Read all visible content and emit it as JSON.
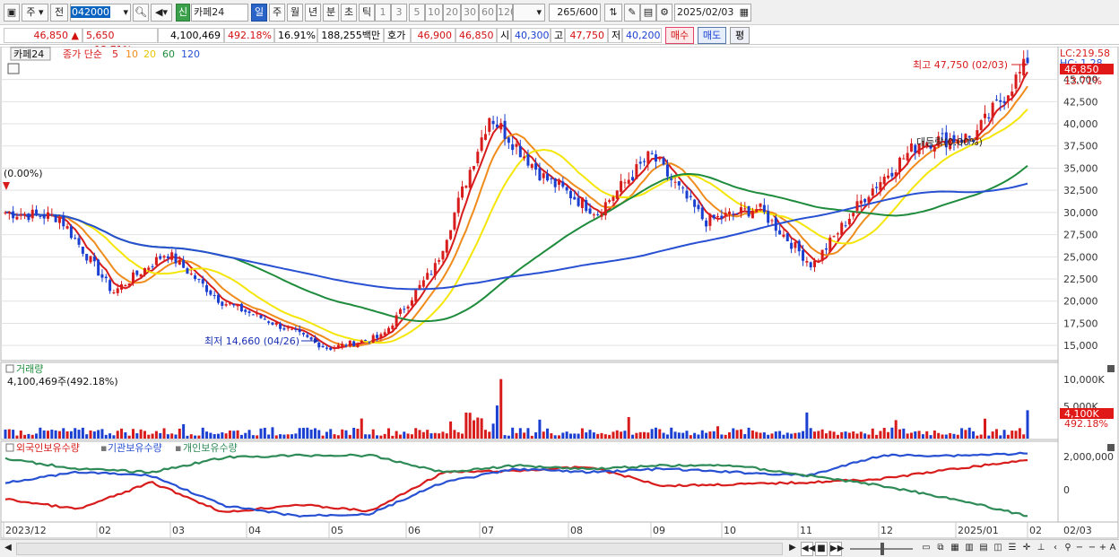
{
  "toolbar": {
    "period_label": "주",
    "prev_label": "전",
    "code_value": "042000",
    "credit_badge": "신",
    "stock_name": "카페24",
    "timeframes": [
      "일",
      "주",
      "월",
      "년",
      "분",
      "초",
      "틱"
    ],
    "active_timeframe": "일",
    "intervals": [
      "1",
      "3",
      "5",
      "10",
      "20",
      "30",
      "60",
      "120"
    ],
    "count_value": "265",
    "count_total": "/600",
    "date_value": "2025/02/03"
  },
  "quote": {
    "price": "46,850",
    "change_arrow": "▲",
    "change": "5,650",
    "change_pct": "+13.71%",
    "volume": "4,100,469",
    "volume_ratio": "492.18%",
    "turnover": "16.91%",
    "amount": "188,255백만",
    "ask_label": "호가",
    "ask_price": "46,900",
    "bid_price": "46,850",
    "open_label": "시",
    "open": "40,300",
    "high_label": "고",
    "high": "47,750",
    "low_label": "저",
    "low": "40,200",
    "buy_label": "매수",
    "sell_label": "매도",
    "eval_label": "평"
  },
  "price_panel": {
    "legend_name": "카페24",
    "legend_ma": "종가 단순",
    "ma_periods": [
      "5",
      "10",
      "20",
      "60",
      "120"
    ],
    "ma_colors": [
      "#d81c1c",
      "#f08c1c",
      "#f5e60a",
      "#1e8c3c",
      "#2850d2"
    ],
    "left_pct": "(0.00%)",
    "high_annot": "최고 47,750 (02/03)",
    "low_annot": "최저 14,660 (04/26)",
    "mid_annot": "대등락(0.00%)",
    "lc_label": "LC:219.58",
    "hc_label": "HC: 1.28",
    "current_price_tag": "46,850",
    "current_pct_tag": "13.71%",
    "y_ticks": [
      "45,000",
      "42,500",
      "40,000",
      "37,500",
      "35,000",
      "32,500",
      "30,000",
      "27,500",
      "25,000",
      "22,500",
      "20,000",
      "17,500",
      "15,000"
    ]
  },
  "volume_panel": {
    "title": "거래량",
    "value_text": "4,100,469주(492.18%)",
    "y_ticks": [
      "10,000K",
      "5,000K"
    ],
    "current_tag": "4,100K",
    "current_pct": "492.18%"
  },
  "holdings_panel": {
    "legend": [
      "외국인보유수량",
      "기관보유수량",
      "개인보유수량"
    ],
    "colors": [
      "#d81c1c",
      "#2850d2",
      "#2e8b57"
    ],
    "y_ticks": [
      "2,000,000",
      "0"
    ]
  },
  "x_axis": {
    "labels": [
      "2023/12",
      "02",
      "03",
      "04",
      "05",
      "06",
      "07",
      "08",
      "09",
      "10",
      "11",
      "12",
      "2025/01",
      "02"
    ],
    "right_label": "02/03"
  },
  "chart_data": {
    "type": "line",
    "title": "카페24",
    "series_close_key_points": [
      {
        "date": "2023/12",
        "close": 30000
      },
      {
        "date": "2024/01",
        "close": 29500
      },
      {
        "date": "2024/02",
        "close": 21000
      },
      {
        "date": "2024/02 end",
        "close": 25500
      },
      {
        "date": "2024/03",
        "close": 20000
      },
      {
        "date": "2024/04",
        "close": 17500
      },
      {
        "date": "2024/04/26",
        "close": 14660
      },
      {
        "date": "2024/05",
        "close": 16000
      },
      {
        "date": "2024/06",
        "close": 24000
      },
      {
        "date": "2024/06 end",
        "close": 41000
      },
      {
        "date": "2024/07",
        "close": 34000
      },
      {
        "date": "2024/08",
        "close": 30000
      },
      {
        "date": "2024/08 end",
        "close": 36500
      },
      {
        "date": "2024/09",
        "close": 29000
      },
      {
        "date": "2024/10",
        "close": 30500
      },
      {
        "date": "2024/11",
        "close": 24000
      },
      {
        "date": "2024/12",
        "close": 32000
      },
      {
        "date": "2024/12 end",
        "close": 38000
      },
      {
        "date": "2025/01",
        "close": 38500
      },
      {
        "date": "2025/02/03",
        "close": 46850
      }
    ],
    "ylim": [
      13500,
      48500
    ],
    "high": 47750,
    "low": 14660
  }
}
